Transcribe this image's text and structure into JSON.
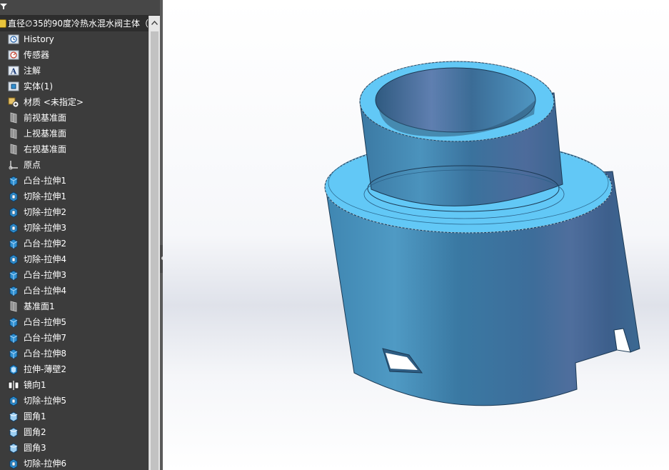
{
  "tree": {
    "root_label": "直径∅35的90度冷热水混水阀主体（",
    "items": [
      {
        "label": "History",
        "icon": "history-icon"
      },
      {
        "label": "传感器",
        "icon": "sensor-icon"
      },
      {
        "label": "注解",
        "icon": "annotation-icon"
      },
      {
        "label": "实体(1)",
        "icon": "solid-bodies-icon"
      },
      {
        "label": "材质 <未指定>",
        "icon": "material-icon"
      },
      {
        "label": "前视基准面",
        "icon": "plane-icon"
      },
      {
        "label": "上视基准面",
        "icon": "plane-icon"
      },
      {
        "label": "右视基准面",
        "icon": "plane-icon"
      },
      {
        "label": "原点",
        "icon": "origin-icon"
      },
      {
        "label": "凸台-拉伸1",
        "icon": "boss-extrude-icon"
      },
      {
        "label": "切除-拉伸1",
        "icon": "cut-extrude-icon"
      },
      {
        "label": "切除-拉伸2",
        "icon": "cut-extrude-icon"
      },
      {
        "label": "切除-拉伸3",
        "icon": "cut-extrude-icon"
      },
      {
        "label": "凸台-拉伸2",
        "icon": "boss-extrude-icon"
      },
      {
        "label": "切除-拉伸4",
        "icon": "cut-extrude-icon"
      },
      {
        "label": "凸台-拉伸3",
        "icon": "boss-extrude-icon"
      },
      {
        "label": "凸台-拉伸4",
        "icon": "boss-extrude-icon"
      },
      {
        "label": "基准面1",
        "icon": "plane-icon"
      },
      {
        "label": "凸台-拉伸5",
        "icon": "boss-extrude-icon"
      },
      {
        "label": "凸台-拉伸7",
        "icon": "boss-extrude-icon"
      },
      {
        "label": "凸台-拉伸8",
        "icon": "boss-extrude-icon"
      },
      {
        "label": "拉伸-薄壁2",
        "icon": "thin-extrude-icon"
      },
      {
        "label": "镜向1",
        "icon": "mirror-icon"
      },
      {
        "label": "切除-拉伸5",
        "icon": "cut-extrude-icon"
      },
      {
        "label": "圆角1",
        "icon": "fillet-icon"
      },
      {
        "label": "圆角2",
        "icon": "fillet-icon"
      },
      {
        "label": "圆角3",
        "icon": "fillet-icon"
      },
      {
        "label": "切除-拉伸6",
        "icon": "cut-extrude-icon"
      }
    ]
  },
  "colors": {
    "panel_bg": "#3c3c3c",
    "model_face": "#3d7fa8",
    "model_cap": "#62c8f6"
  }
}
